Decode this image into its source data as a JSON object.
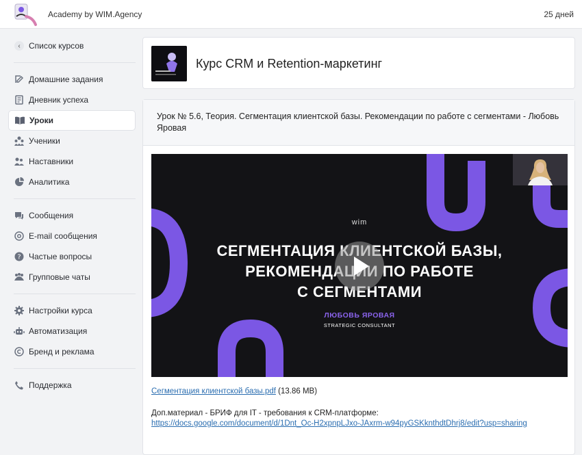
{
  "header": {
    "app_title": "Academy by WIM.Agency",
    "days_left": "25 дней"
  },
  "sidebar": {
    "back": {
      "label": "Список курсов",
      "icon": "chevron-left-icon"
    },
    "groups": [
      [
        {
          "label": "Домашние задания",
          "icon": "edit-icon",
          "active": false
        },
        {
          "label": "Дневник успеха",
          "icon": "notebook-icon",
          "active": false
        },
        {
          "label": "Уроки",
          "icon": "book-icon",
          "active": true
        },
        {
          "label": "Ученики",
          "icon": "students-icon",
          "active": false
        },
        {
          "label": "Наставники",
          "icon": "mentors-icon",
          "active": false
        },
        {
          "label": "Аналитика",
          "icon": "pie-chart-icon",
          "active": false
        }
      ],
      [
        {
          "label": "Сообщения",
          "icon": "messages-icon",
          "active": false
        },
        {
          "label": "E-mail сообщения",
          "icon": "at-icon",
          "active": false
        },
        {
          "label": "Частые вопросы",
          "icon": "question-icon",
          "active": false
        },
        {
          "label": "Групповые чаты",
          "icon": "group-icon",
          "active": false
        }
      ],
      [
        {
          "label": "Настройки курса",
          "icon": "gear-icon",
          "active": false
        },
        {
          "label": "Автоматизация",
          "icon": "robot-icon",
          "active": false
        },
        {
          "label": "Бренд и реклама",
          "icon": "copyright-icon",
          "active": false
        }
      ],
      [
        {
          "label": "Поддержка",
          "icon": "phone-icon",
          "active": false
        }
      ]
    ]
  },
  "course": {
    "title": "Курс CRM и Retention-маркетинг"
  },
  "lesson": {
    "title": "Урок № 5.6, Теория. Сегментация клиентской базы. Рекомендации по работе с сегментами - Любовь Яровая",
    "video": {
      "brand": "wim",
      "title_lines": [
        "СЕГМЕНТАЦИЯ КЛИЕНТСКОЙ БАЗЫ,",
        "РЕКОМЕНДАЦИИ ПО РАБОТЕ",
        "С СЕГМЕНТАМИ"
      ],
      "speaker": "ЛЮБОВЬ ЯРОВАЯ",
      "role": "STRATEGIC CONSULTANT"
    },
    "file": {
      "name": "Сегментация клиентской базы.pdf",
      "size": "(13.86 MB)"
    },
    "extra_text": "Доп.материал - БРИФ для IT - требования к CRM-платформе:",
    "extra_link": "https://docs.google.com/document/d/1Dnt_Oc-H2xpnpLJxo-JAxrm-w94pyGSKknthdtDhrj8/edit?usp=sharing"
  },
  "colors": {
    "accent": "#7b57e4",
    "link": "#2a6db0",
    "video_bg": "#131316"
  }
}
